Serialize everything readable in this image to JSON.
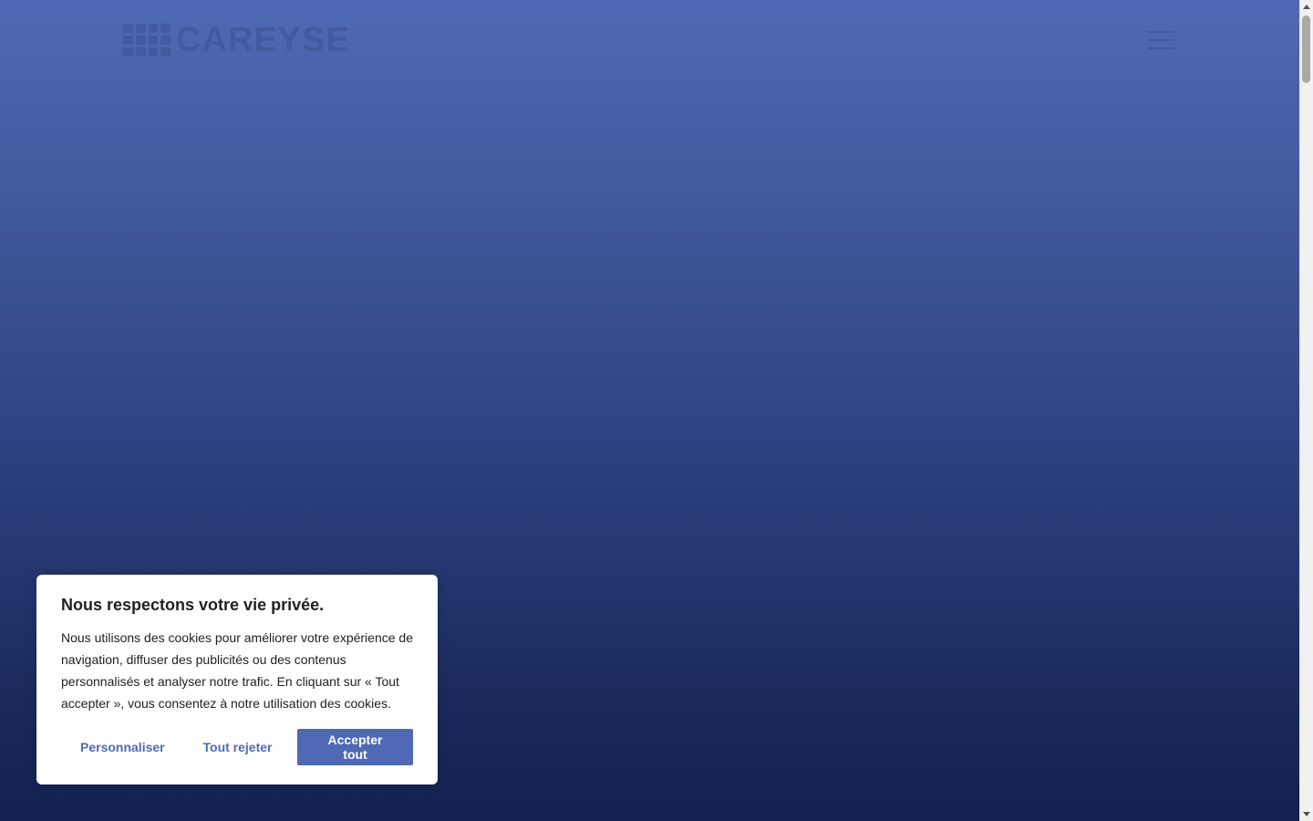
{
  "header": {
    "logo_text": "CAREYSE"
  },
  "cookie_banner": {
    "title": "Nous respectons votre vie privée.",
    "text": "Nous utilisons des cookies pour améliorer votre expérience de navigation, diffuser des publicités ou des contenus personnalisés et analyser notre trafic. En cliquant sur « Tout accepter », vous consentez à notre utilisation des cookies.",
    "buttons": {
      "customize": "Personnaliser",
      "reject": "Tout rejeter",
      "accept": "Accepter tout"
    }
  },
  "icons": {
    "menu": "hamburger-menu-icon",
    "logo_mark": "logo-grid-icon"
  },
  "colors": {
    "accent": "#4f69b4",
    "background_top": "#4f69b4",
    "background_bottom": "#132150",
    "banner_bg": "#ffffff",
    "text": "#212121"
  }
}
